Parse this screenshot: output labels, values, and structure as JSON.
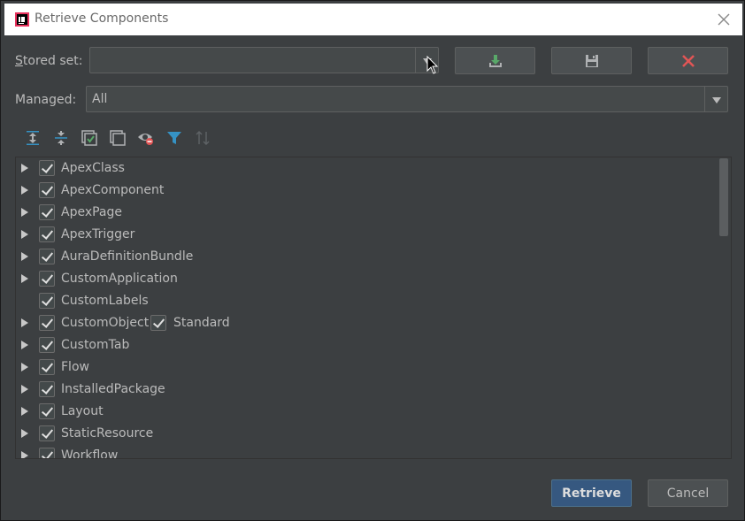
{
  "window": {
    "title": "Retrieve Components",
    "app_icon": "intellij-icon",
    "close_icon": "close-icon"
  },
  "stored_set": {
    "label_prefix": "S",
    "label_rest": "tored set:",
    "value": "",
    "buttons": [
      {
        "name": "load-stored-set-button",
        "icon": "download-icon",
        "color": "#59a869"
      },
      {
        "name": "save-stored-set-button",
        "icon": "save-icon",
        "color": "#afb1b3"
      },
      {
        "name": "delete-stored-set-button",
        "icon": "delete-icon",
        "color": "#e05555"
      }
    ]
  },
  "managed": {
    "label": "Managed:",
    "value": "All"
  },
  "toolbar": {
    "icons": [
      "expand-all-icon",
      "collapse-all-icon",
      "select-all-icon",
      "deselect-all-icon",
      "visibility-icon",
      "filter-icon",
      "sort-icon"
    ]
  },
  "tree": {
    "items": [
      {
        "label": "ApexClass",
        "expandable": true,
        "checked": true
      },
      {
        "label": "ApexComponent",
        "expandable": true,
        "checked": true
      },
      {
        "label": "ApexPage",
        "expandable": true,
        "checked": true
      },
      {
        "label": "ApexTrigger",
        "expandable": true,
        "checked": true
      },
      {
        "label": "AuraDefinitionBundle",
        "expandable": true,
        "checked": true
      },
      {
        "label": "CustomApplication",
        "expandable": true,
        "checked": true
      },
      {
        "label": "CustomLabels",
        "expandable": false,
        "checked": true
      },
      {
        "label": "CustomObject",
        "expandable": true,
        "checked": true,
        "extra_label": "Standard",
        "extra_checked": true
      },
      {
        "label": "CustomTab",
        "expandable": true,
        "checked": true
      },
      {
        "label": "Flow",
        "expandable": true,
        "checked": true
      },
      {
        "label": "InstalledPackage",
        "expandable": true,
        "checked": true
      },
      {
        "label": "Layout",
        "expandable": true,
        "checked": true
      },
      {
        "label": "StaticResource",
        "expandable": true,
        "checked": true
      },
      {
        "label": "Workflow",
        "expandable": true,
        "checked": true
      }
    ]
  },
  "footer": {
    "retrieve_label": "Retrieve",
    "cancel_label": "Cancel"
  },
  "colors": {
    "background": "#3c3f41",
    "primary_button": "#365880",
    "filter_icon": "#3592c4"
  }
}
